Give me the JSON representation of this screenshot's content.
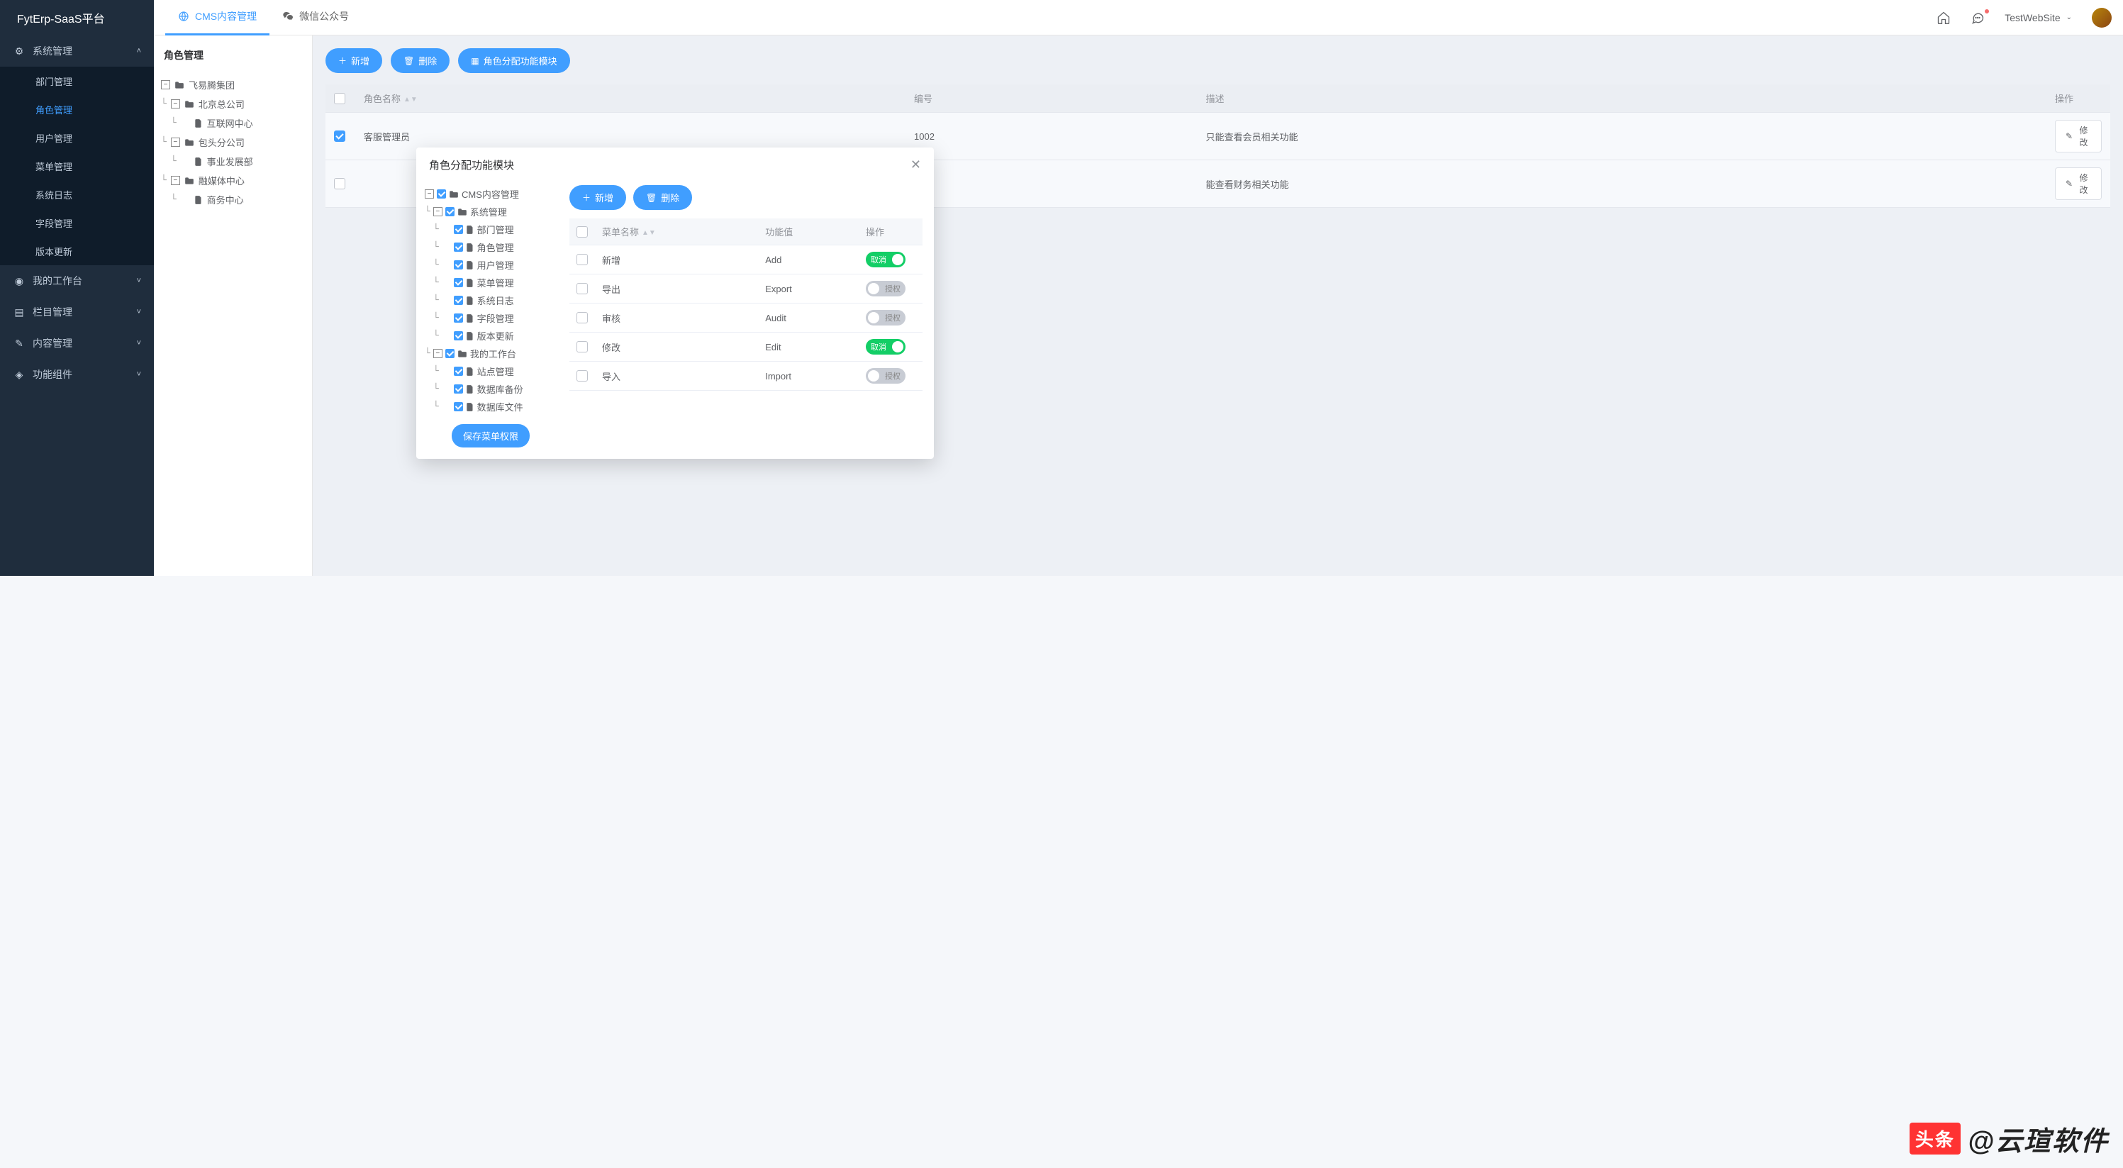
{
  "app_title": "FytErp-SaaS平台",
  "topbar": {
    "tabs": [
      {
        "icon": "globe",
        "label": "CMS内容管理",
        "active": true
      },
      {
        "icon": "wechat",
        "label": "微信公众号",
        "active": false
      }
    ],
    "user_name": "TestWebSite"
  },
  "sidebar": {
    "groups": [
      {
        "title": "系统管理",
        "icon": "gear",
        "open": true,
        "items": [
          {
            "label": "部门管理"
          },
          {
            "label": "角色管理",
            "active": true
          },
          {
            "label": "用户管理"
          },
          {
            "label": "菜单管理"
          },
          {
            "label": "系统日志"
          },
          {
            "label": "字段管理"
          },
          {
            "label": "版本更新"
          }
        ]
      },
      {
        "title": "我的工作台",
        "icon": "dashboard",
        "open": false
      },
      {
        "title": "栏目管理",
        "icon": "columns",
        "open": false
      },
      {
        "title": "内容管理",
        "icon": "doc",
        "open": false
      },
      {
        "title": "功能组件",
        "icon": "cube",
        "open": false
      }
    ]
  },
  "left_panel": {
    "title": "角色管理",
    "tree": [
      {
        "depth": 0,
        "toggle": "-",
        "icon": "folder",
        "label": "飞易腾集团"
      },
      {
        "depth": 1,
        "toggle": "-",
        "icon": "folder",
        "label": "北京总公司"
      },
      {
        "depth": 2,
        "toggle": null,
        "icon": "file",
        "label": "互联网中心"
      },
      {
        "depth": 1,
        "toggle": "-",
        "icon": "folder",
        "label": "包头分公司"
      },
      {
        "depth": 2,
        "toggle": null,
        "icon": "file",
        "label": "事业发展部"
      },
      {
        "depth": 1,
        "toggle": "-",
        "icon": "folder",
        "label": "融媒体中心"
      },
      {
        "depth": 2,
        "toggle": null,
        "icon": "file",
        "label": "商务中心"
      }
    ]
  },
  "toolbar": {
    "add": "新增",
    "delete": "删除",
    "assign": "角色分配功能模块"
  },
  "role_table": {
    "headers": {
      "name": "角色名称",
      "code": "编号",
      "desc": "描述",
      "op": "操作"
    },
    "rows": [
      {
        "checked": true,
        "name": "客服管理员",
        "code": "1002",
        "desc": "只能查看会员相关功能",
        "edit": "修改"
      },
      {
        "checked": false,
        "name": "",
        "code": "",
        "desc": "能查看财务相关功能",
        "edit": "修改"
      }
    ]
  },
  "modal": {
    "title": "角色分配功能模块",
    "save_label": "保存菜单权限",
    "add": "新增",
    "delete": "删除",
    "tree": [
      {
        "depth": 0,
        "toggle": "-",
        "icon": "folder",
        "label": "CMS内容管理"
      },
      {
        "depth": 1,
        "toggle": "-",
        "icon": "folder",
        "label": "系统管理"
      },
      {
        "depth": 2,
        "toggle": null,
        "icon": "file",
        "label": "部门管理"
      },
      {
        "depth": 2,
        "toggle": null,
        "icon": "file",
        "label": "角色管理"
      },
      {
        "depth": 2,
        "toggle": null,
        "icon": "file",
        "label": "用户管理"
      },
      {
        "depth": 2,
        "toggle": null,
        "icon": "file",
        "label": "菜单管理"
      },
      {
        "depth": 2,
        "toggle": null,
        "icon": "file",
        "label": "系统日志"
      },
      {
        "depth": 2,
        "toggle": null,
        "icon": "file",
        "label": "字段管理"
      },
      {
        "depth": 2,
        "toggle": null,
        "icon": "file",
        "label": "版本更新"
      },
      {
        "depth": 1,
        "toggle": "-",
        "icon": "folder",
        "label": "我的工作台"
      },
      {
        "depth": 2,
        "toggle": null,
        "icon": "file",
        "label": "站点管理"
      },
      {
        "depth": 2,
        "toggle": null,
        "icon": "file",
        "label": "数据库备份"
      },
      {
        "depth": 2,
        "toggle": null,
        "icon": "file",
        "label": "数据库文件"
      }
    ],
    "func_table": {
      "headers": {
        "name": "菜单名称",
        "value": "功能值",
        "op": "操作"
      },
      "rows": [
        {
          "name": "新增",
          "value": "Add",
          "on": true
        },
        {
          "name": "导出",
          "value": "Export",
          "on": false
        },
        {
          "name": "审核",
          "value": "Audit",
          "on": false
        },
        {
          "name": "修改",
          "value": "Edit",
          "on": true
        },
        {
          "name": "导入",
          "value": "Import",
          "on": false
        }
      ],
      "toggle_on_label": "取消",
      "toggle_off_label": "授权"
    }
  },
  "watermark": {
    "brand": "头条",
    "author": "@云瑄软件"
  }
}
